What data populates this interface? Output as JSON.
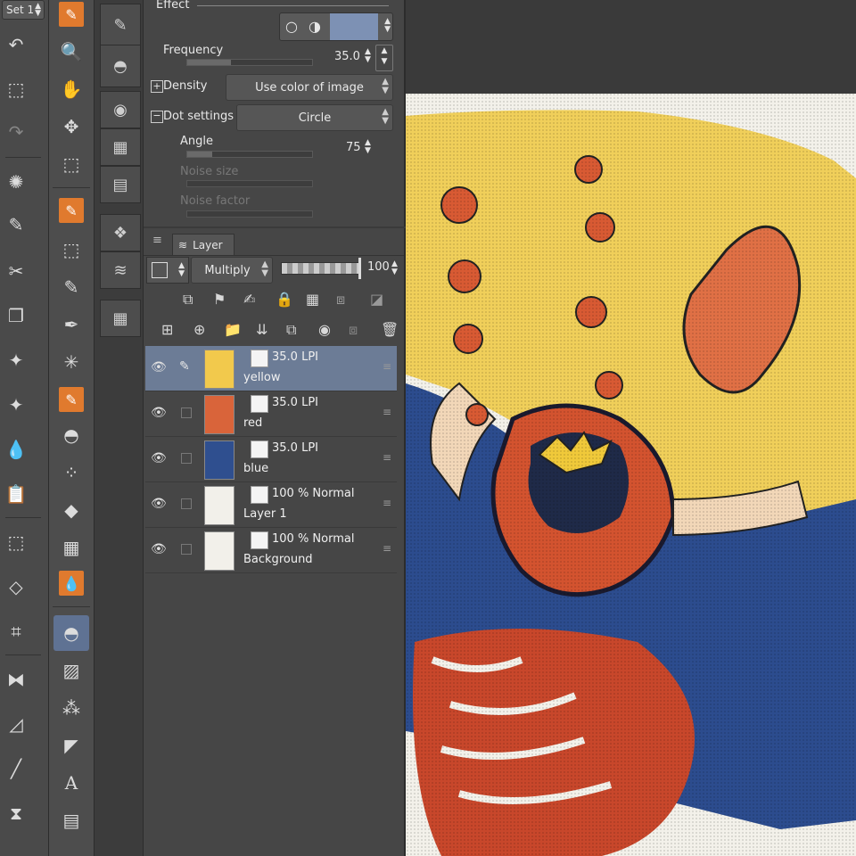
{
  "tool_set_label": "Set 1",
  "effect": {
    "section_title": "Effect",
    "frequency_label": "Frequency",
    "frequency_value": "35.0",
    "frequency_level": 0.35,
    "density_label": "Density",
    "density_value": "Use color of image",
    "dot_settings_label": "Dot settings",
    "dot_shape_value": "Circle",
    "angle_label": "Angle",
    "angle_value": "75",
    "angle_level": 0.2,
    "noise_size_label": "Noise size",
    "noise_factor_label": "Noise factor"
  },
  "layer_panel": {
    "tab_label": "Layer",
    "blend_mode": "Multiply",
    "opacity_value": "100",
    "layers": [
      {
        "mode": "35.0 LPI",
        "name": "yellow",
        "selected": true,
        "thumb_color": "#f2c94c"
      },
      {
        "mode": "35.0 LPI",
        "name": "red",
        "selected": false,
        "thumb_color": "#d9643a"
      },
      {
        "mode": "35.0 LPI",
        "name": "blue",
        "selected": false,
        "thumb_color": "#2f4f8f"
      },
      {
        "mode": "100 % Normal",
        "name": "Layer 1",
        "selected": false,
        "thumb_color": "#f2f0ea"
      },
      {
        "mode": "100 % Normal",
        "name": "Background",
        "selected": false,
        "thumb_color": "#f2f0ea"
      }
    ]
  },
  "colors": {
    "accent_orange": "#e07a2e",
    "selection_blue": "#6c7c96",
    "panel_bg": "#464646"
  },
  "icons": {
    "col1": [
      "undo-icon",
      "transform-icon",
      "redo-icon",
      "loading-icon",
      "eyedropper-icon",
      "cut-icon",
      "copy-icon",
      "sparkle-icon",
      "sparkle-icon",
      "drops-icon",
      "paste-icon",
      "scale-icon",
      "free-transform-icon",
      "mesh-icon",
      "flip-icon",
      "ruler-icon",
      "line-icon",
      "symmetry-icon"
    ],
    "col2": [
      "pen-icon",
      "zoom-icon",
      "hand-icon",
      "move-icon",
      "selection-icon",
      "pen-icon",
      "object-select-icon",
      "eyedropper-icon",
      "pen-tool-icon",
      "sparkle-icon",
      "pen-icon",
      "fill-icon",
      "airbrush-icon",
      "eraser-icon",
      "blend-icon",
      "blend-orange-icon",
      "fill-selected-icon",
      "gradient-icon",
      "effect-icon",
      "figure-icon",
      "text-icon",
      "frame-icon"
    ]
  }
}
